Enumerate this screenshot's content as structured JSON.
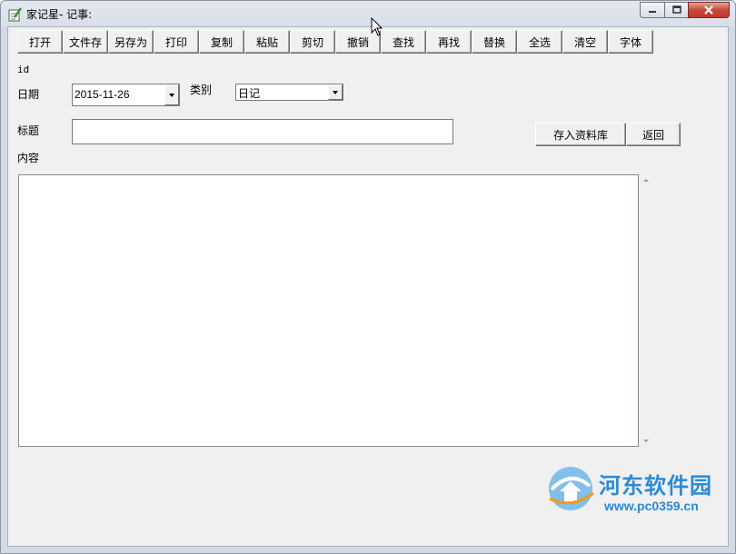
{
  "window": {
    "title": "家记星- 记事:",
    "controls": {
      "minimize": "minimize-icon",
      "maximize": "maximize-icon",
      "close": "close-icon"
    }
  },
  "toolbar": {
    "buttons": [
      "打开",
      "文件存",
      "另存为",
      "打印",
      "复制",
      "粘贴",
      "剪切",
      "撤销",
      "查找",
      "再找",
      "替换",
      "全选",
      "清空",
      "字体"
    ]
  },
  "form": {
    "id_label": "id",
    "date_label": "日期",
    "date_value": "2015-11-26",
    "category_label": "类别",
    "category_value": "日记",
    "title_label": "标题",
    "title_value": "",
    "content_label": "内容",
    "content_value": "",
    "save_button": "存入资料库",
    "back_button": "返回"
  },
  "watermark": {
    "name": "河东软件园",
    "url": "www.pc0359.cn"
  },
  "colors": {
    "client_bg": "#f0f0f0",
    "watermark": "#2b8ad6",
    "close_button": "#c8473a"
  }
}
